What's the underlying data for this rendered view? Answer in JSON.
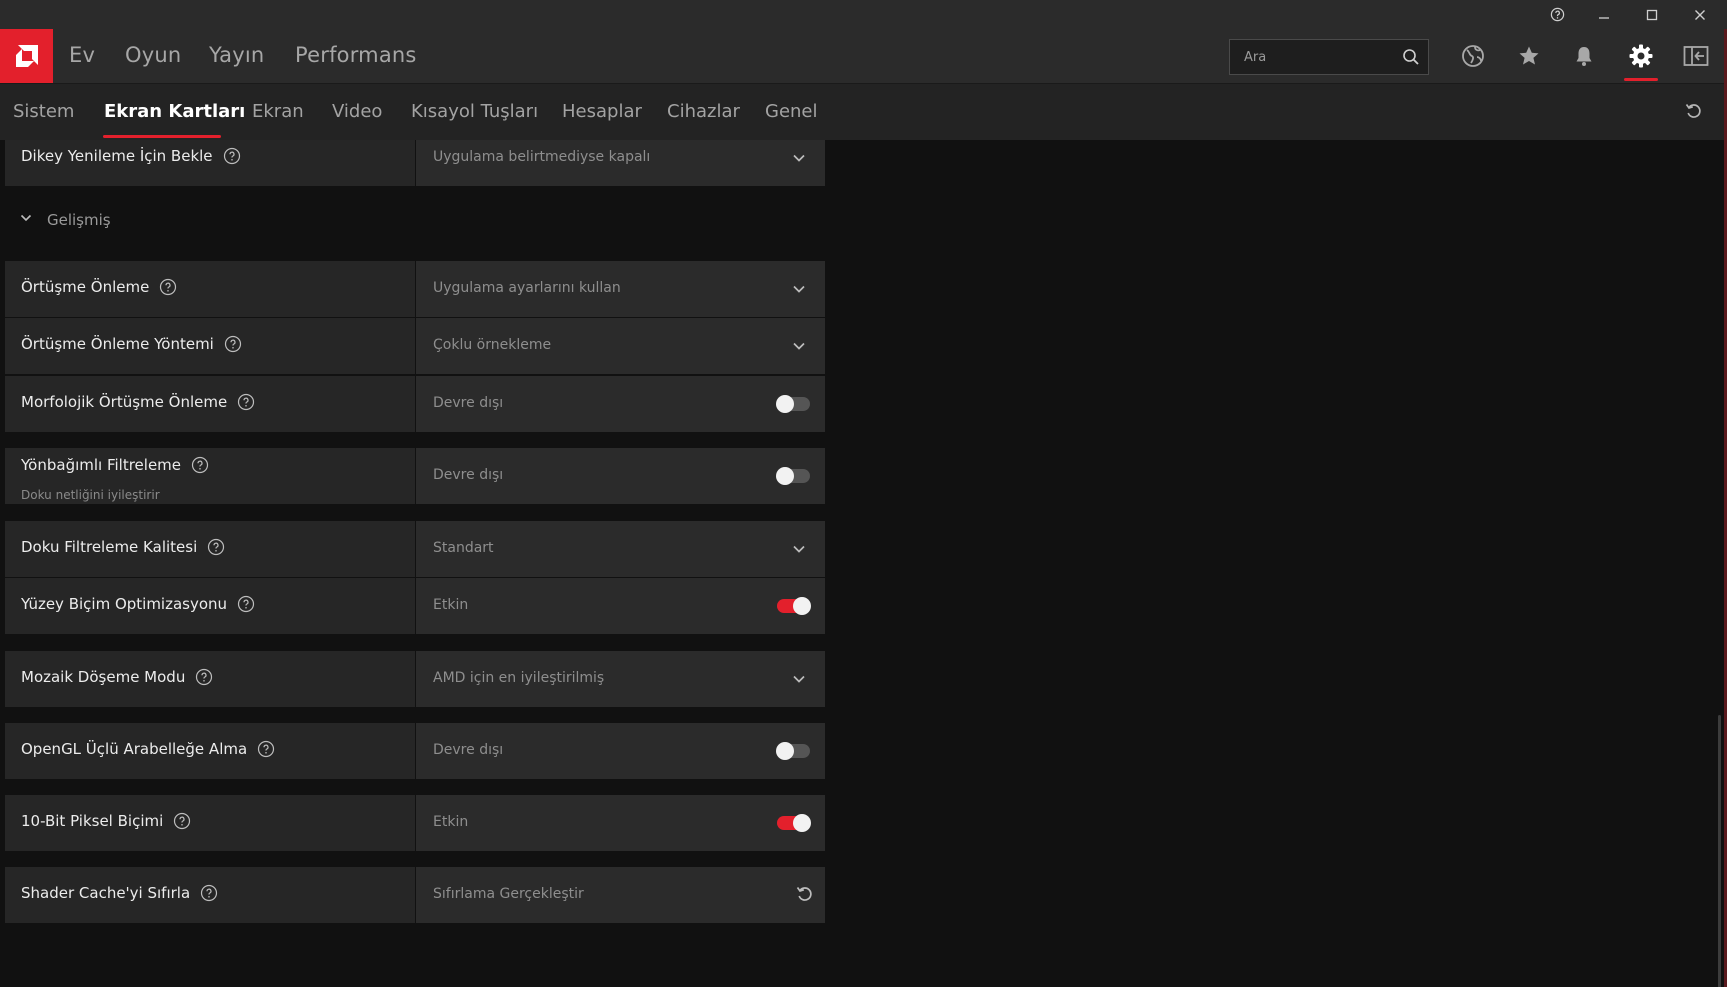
{
  "titlebar": {
    "buttons": [
      "help",
      "minimize",
      "maximize",
      "close"
    ]
  },
  "nav": {
    "links": [
      "Ev",
      "Oyun",
      "Yayın",
      "Performans"
    ],
    "search_placeholder": "Ara",
    "accent": "#e3202c"
  },
  "subnav": {
    "tabs": [
      "Sistem",
      "Ekran Kartları",
      "Ekran",
      "Video",
      "Kısayol Tuşları",
      "Hesaplar",
      "Cihazlar",
      "Genel"
    ],
    "active": "Ekran Kartları"
  },
  "settings": {
    "vsync": {
      "label": "Dikey Yenileme İçin Bekle",
      "value": "Uygulama belirtmediyse kapalı"
    },
    "section_label": "Gelişmiş",
    "rows": [
      {
        "label": "Örtüşme Önleme",
        "value": "Uygulama ayarlarını kullan",
        "control": "dropdown"
      },
      {
        "label": "Örtüşme Önleme Yöntemi",
        "value": "Çoklu örnekleme",
        "control": "dropdown"
      },
      {
        "label": "Morfolojik Örtüşme Önleme",
        "value": "Devre dışı",
        "control": "toggle",
        "on": false
      },
      {
        "label": "Yönbağımlı Filtreleme",
        "sublabel": "Doku netliğini iyileştirir",
        "value": "Devre dışı",
        "control": "toggle",
        "on": false
      },
      {
        "label": "Doku Filtreleme Kalitesi",
        "value": "Standart",
        "control": "dropdown"
      },
      {
        "label": "Yüzey Biçim Optimizasyonu",
        "value": "Etkin",
        "control": "toggle",
        "on": true
      },
      {
        "label": "Mozaik Döşeme Modu",
        "value": "AMD için en iyileştirilmiş",
        "control": "dropdown"
      },
      {
        "label": "OpenGL Üçlü Arabelleğe Alma",
        "value": "Devre dışı",
        "control": "toggle",
        "on": false
      },
      {
        "label": "10-Bit Piksel Biçimi",
        "value": "Etkin",
        "control": "toggle",
        "on": true
      },
      {
        "label": "Shader Cache'yi Sıfırla",
        "value": "Sıfırlama Gerçekleştir",
        "control": "reset"
      }
    ]
  }
}
